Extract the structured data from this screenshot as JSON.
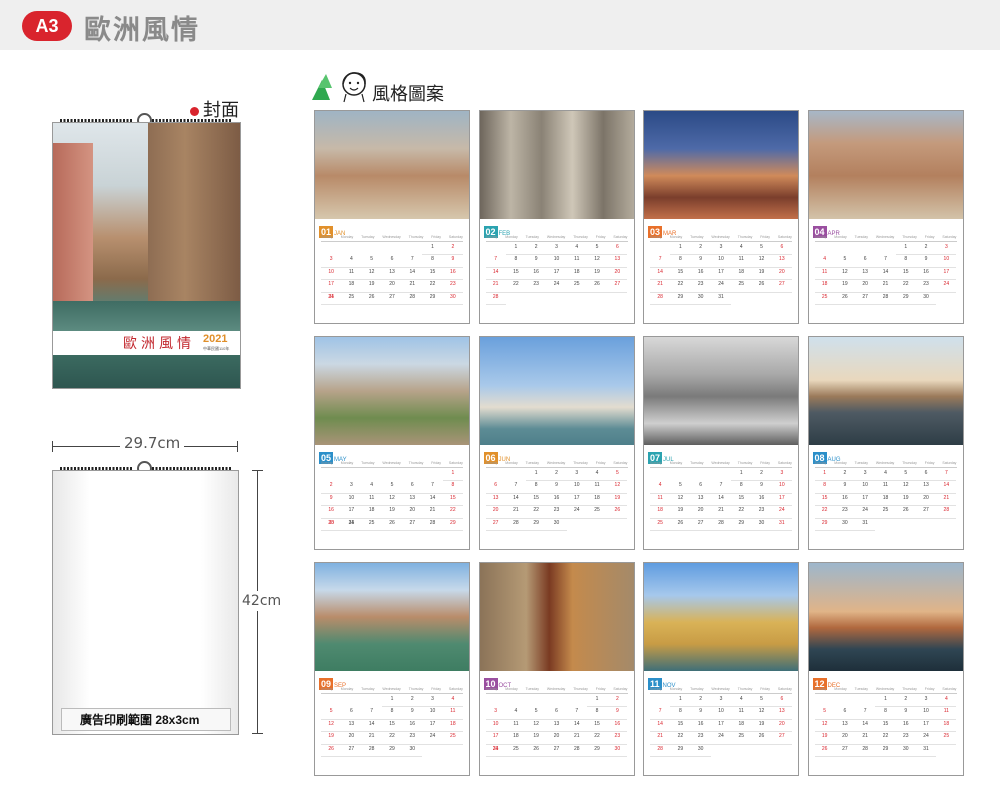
{
  "header": {
    "badge": "A3",
    "title": "歐洲風情"
  },
  "cover": {
    "label": "封面",
    "title": "歐洲風情",
    "year": "2021",
    "sublabel": "中華民國110年"
  },
  "dimensions": {
    "width_label": "29.7cm",
    "height_label": "42cm"
  },
  "ad_area": {
    "text": "廣告印刷範圍 28x3cm"
  },
  "style_section": {
    "label": "風格圖案"
  },
  "colors": {
    "accent": "#d9242d",
    "header_bg": "#efefef"
  },
  "weekdays": [
    "Sunday",
    "Monday",
    "Tuesday",
    "Wednesday",
    "Thursday",
    "Friday",
    "Saturday"
  ],
  "months": [
    {
      "num": "01",
      "name": "JAN",
      "color": "#e1902b",
      "start": 5,
      "days": 31,
      "photo": "venice-roofs"
    },
    {
      "num": "02",
      "name": "FEB",
      "color": "#2ba3b0",
      "start": 1,
      "days": 28,
      "photo": "statues"
    },
    {
      "num": "03",
      "name": "MAR",
      "color": "#e8702a",
      "start": 1,
      "days": 31,
      "photo": "dusk-bridge"
    },
    {
      "num": "04",
      "name": "APR",
      "color": "#9a4fa0",
      "start": 4,
      "days": 30,
      "photo": "city-aerial"
    },
    {
      "num": "05",
      "name": "MAY",
      "color": "#2b8fc9",
      "start": 6,
      "days": 31,
      "photo": "rome-aerial"
    },
    {
      "num": "06",
      "name": "JUN",
      "color": "#e1902b",
      "start": 2,
      "days": 30,
      "photo": "church-island"
    },
    {
      "num": "07",
      "name": "JUL",
      "color": "#2ba3b0",
      "start": 4,
      "days": 31,
      "photo": "bw-lagoon"
    },
    {
      "num": "08",
      "name": "AUG",
      "color": "#2b8fc9",
      "start": 0,
      "days": 31,
      "photo": "cranes-sunset"
    },
    {
      "num": "09",
      "name": "SEP",
      "color": "#e8702a",
      "start": 3,
      "days": 30,
      "photo": "canal"
    },
    {
      "num": "10",
      "name": "OCT",
      "color": "#9a4fa0",
      "start": 5,
      "days": 31,
      "photo": "doorway"
    },
    {
      "num": "11",
      "name": "NOV",
      "color": "#2b8fc9",
      "start": 1,
      "days": 30,
      "photo": "palazzo"
    },
    {
      "num": "12",
      "name": "DEC",
      "color": "#e8702a",
      "start": 3,
      "days": 31,
      "photo": "harbor-dusk"
    }
  ]
}
